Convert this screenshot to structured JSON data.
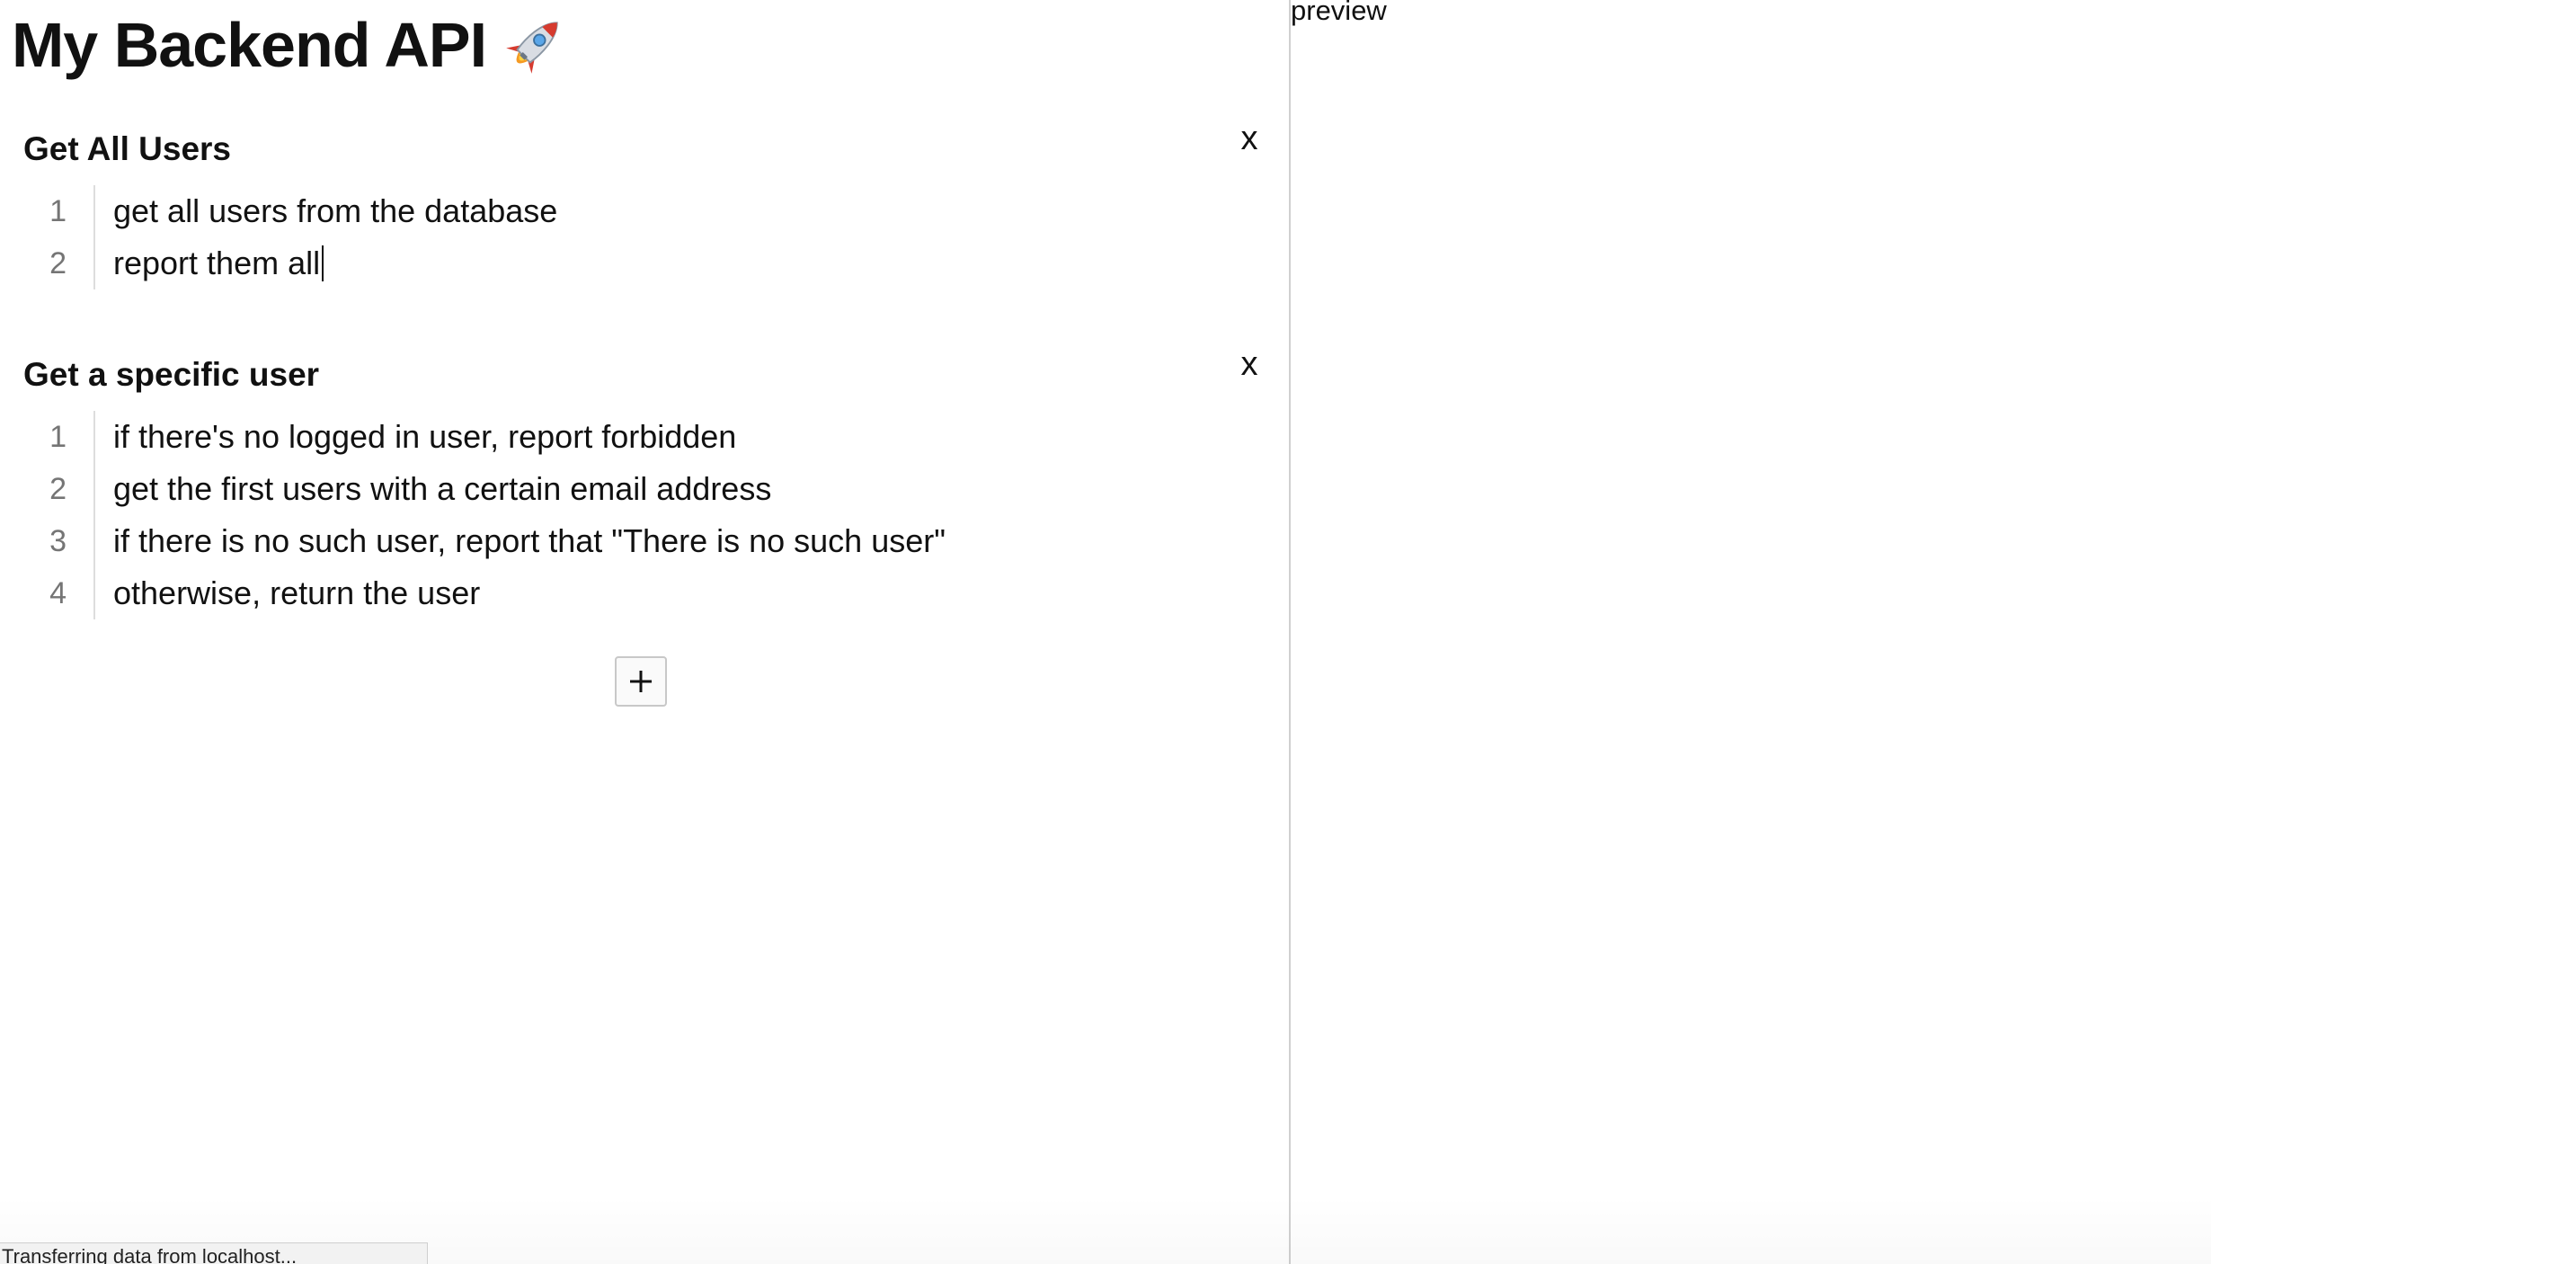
{
  "header": {
    "title": "My Backend API",
    "title_icon": "rocket-icon"
  },
  "endpoints": [
    {
      "title": "Get All Users",
      "close_label": "x",
      "lines": [
        {
          "number": "1",
          "text": "get all users from the database"
        },
        {
          "number": "2",
          "text": "report them all"
        }
      ]
    },
    {
      "title": "Get a specific user",
      "close_label": "x",
      "lines": [
        {
          "number": "1",
          "text": "if there's no logged in user, report forbidden"
        },
        {
          "number": "2",
          "text": "get the first users with a certain email address"
        },
        {
          "number": "3",
          "text": "if there is no such user, report that \"There is no such user\""
        },
        {
          "number": "4",
          "text": "otherwise, return the user"
        }
      ]
    }
  ],
  "add_button": {
    "icon": "plus-icon"
  },
  "preview": {
    "label": "preview"
  },
  "status_bar": {
    "text": "Transferring data from localhost..."
  }
}
